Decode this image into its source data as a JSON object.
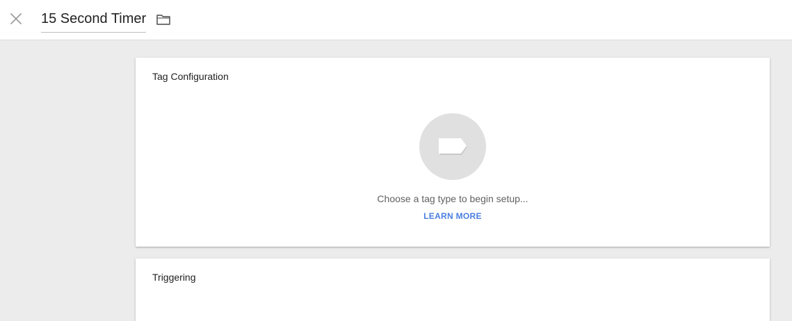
{
  "header": {
    "title": "15 Second Timer",
    "close_icon": "close-icon",
    "folder_icon": "folder-icon"
  },
  "tag_config": {
    "title": "Tag Configuration",
    "tag_icon": "tag-icon",
    "prompt": "Choose a tag type to begin setup...",
    "learn_more": "LEARN MORE"
  },
  "triggering": {
    "title": "Triggering"
  },
  "colors": {
    "accent": "#4a7ee0",
    "background": "#ececec",
    "icon_circle": "#e0e0e0"
  }
}
